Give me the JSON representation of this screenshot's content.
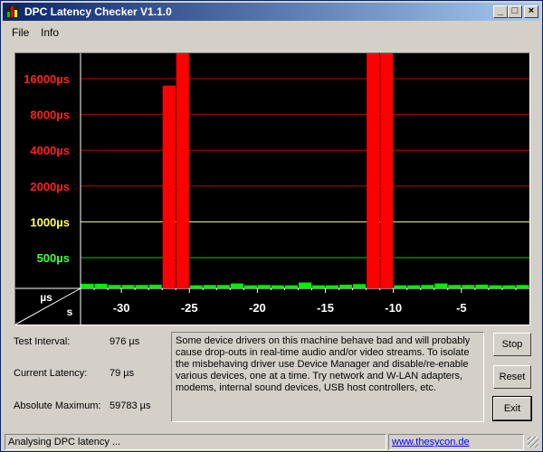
{
  "window": {
    "title": "DPC Latency Checker V1.1.0"
  },
  "titlebar_buttons": {
    "minimize": "_",
    "maximize": "□",
    "close": "×"
  },
  "menu": [
    {
      "label": "File",
      "hotkey": "F"
    },
    {
      "label": "Info",
      "hotkey": "I"
    }
  ],
  "chart_data": {
    "type": "bar",
    "xlabel": "s",
    "ylabel": "µs",
    "x_ticks": [
      -30,
      -25,
      -20,
      -15,
      -10,
      -5
    ],
    "x_tick_labels": [
      "-30",
      "-25",
      "-20",
      "-15",
      "-10",
      "-5"
    ],
    "xlim": [
      -33,
      0
    ],
    "y_tick_labels": [
      "16000µs",
      "8000µs",
      "4000µs",
      "2000µs",
      "1000µs",
      "500µs"
    ],
    "y_scale": "log2",
    "bars_color_normal": "#00ee00",
    "bars_color_high": "#ff0000",
    "x": [
      -32.5,
      -31.5,
      -30.5,
      -29.5,
      -28.5,
      -27.5,
      -26.5,
      -25.5,
      -24.5,
      -23.5,
      -22.5,
      -21.5,
      -20.5,
      -19.5,
      -18.5,
      -17.5,
      -16.5,
      -15.5,
      -14.5,
      -13.5,
      -12.5,
      -11.5,
      -10.5,
      -9.5,
      -8.5,
      -7.5,
      -6.5,
      -5.5,
      -4.5,
      -3.5,
      -2.5,
      -1.5,
      -0.5
    ],
    "values": [
      75,
      75,
      55,
      55,
      55,
      60,
      14000,
      59783,
      50,
      55,
      55,
      80,
      50,
      55,
      50,
      50,
      95,
      50,
      50,
      60,
      70,
      59783,
      59783,
      50,
      50,
      55,
      80,
      55,
      55,
      60,
      50,
      50,
      55
    ]
  },
  "stats": [
    {
      "label": "Test Interval:",
      "value": "976 µs"
    },
    {
      "label": "Current Latency:",
      "value": "79 µs"
    },
    {
      "label": "Absolute Maximum:",
      "value": "59783 µs"
    }
  ],
  "message": "Some device drivers on this machine behave bad and will probably cause drop-outs in real-time audio and/or video streams. To isolate the misbehaving driver use Device Manager and disable/re-enable various devices, one at a time. Try network and W-LAN adapters, modems, internal sound devices, USB host controllers, etc.",
  "buttons": {
    "stop": "Stop",
    "reset": "Reset",
    "exit": "Exit"
  },
  "status": {
    "text": "Analysing DPC latency ...",
    "link": "www.thesycon.de"
  }
}
